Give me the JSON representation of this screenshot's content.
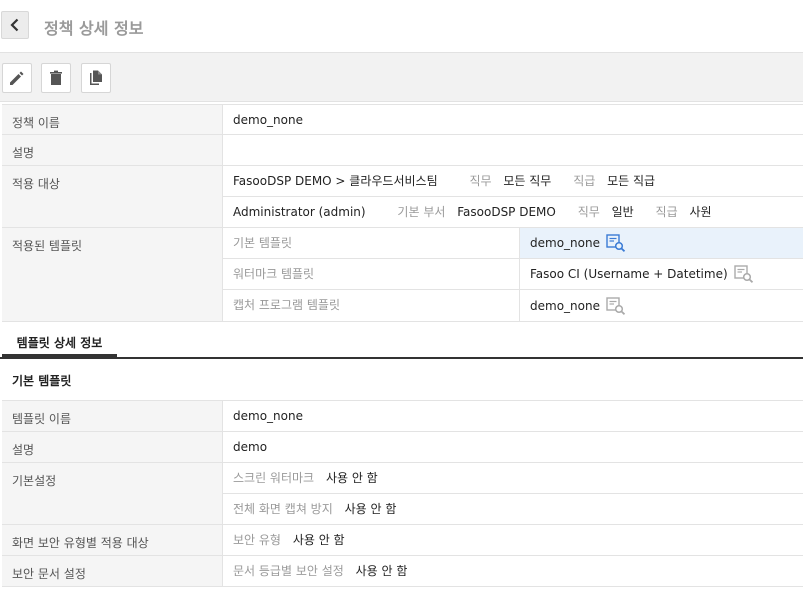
{
  "header": {
    "title": "정책 상세 정보"
  },
  "policy": {
    "name_label": "정책 이름",
    "name_value": "demo_none",
    "desc_label": "설명",
    "desc_value": "",
    "target_label": "적용 대상",
    "targets": [
      {
        "name": "FasooDSP DEMO > 클라우드서비스팀",
        "duty_label": "직무",
        "duty_value": "모든 직무",
        "rank_label": "직급",
        "rank_value": "모든 직급"
      },
      {
        "name": "Administrator (admin)",
        "dept_label": "기본 부서",
        "dept_value": "FasooDSP DEMO",
        "duty_label": "직무",
        "duty_value": "일반",
        "rank_label": "직급",
        "rank_value": "사원"
      }
    ],
    "templates_label": "적용된 템플릿",
    "templates": [
      {
        "name": "기본 템플릿",
        "value": "demo_none"
      },
      {
        "name": "워터마크 템플릿",
        "value": "Fasoo CI (Username + Datetime)"
      },
      {
        "name": "캡처 프로그램 템플릿",
        "value": "demo_none"
      }
    ]
  },
  "tabs": {
    "active": "템플릿 상세 정보"
  },
  "template_detail": {
    "section_title": "기본 템플릿",
    "name_label": "템플릿 이름",
    "name_value": "demo_none",
    "desc_label": "설명",
    "desc_value": "demo",
    "basic_label": "기본설정",
    "basic_items": [
      {
        "key": "스크린 워터마크",
        "value": "사용 안 함"
      },
      {
        "key": "전체 화면 캡쳐 방지",
        "value": "사용 안 함"
      }
    ],
    "screen_label": "화면 보안 유형별 적용 대상",
    "screen_key": "보안 유형",
    "screen_value": "사용 안 함",
    "doc_label": "보안 문서 설정",
    "doc_key": "문서 등급별 보안 설정",
    "doc_value": "사용 안 함"
  },
  "colors": {
    "accent": "#3a7bd5",
    "label_bg": "#f5f5f5",
    "selected_bg": "#e9f2fb"
  }
}
